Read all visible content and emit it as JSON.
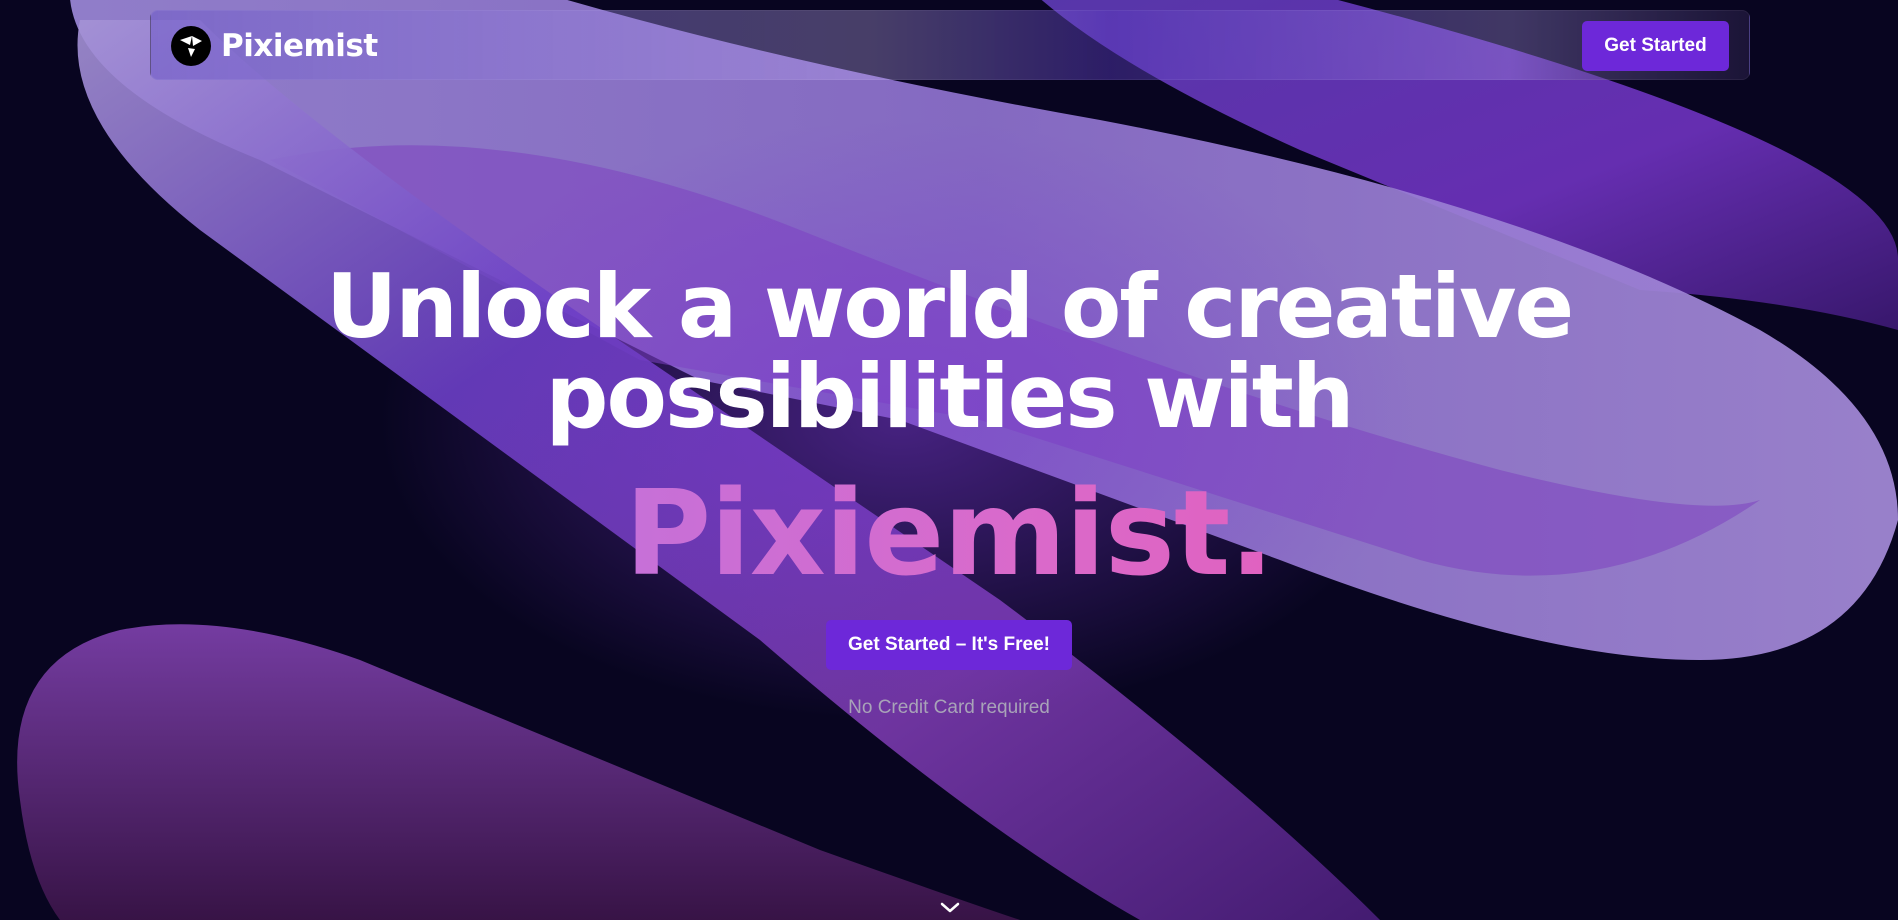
{
  "navbar": {
    "brand_name": "Pixiemist",
    "cta_label": "Get Started"
  },
  "hero": {
    "headline_line1": "Unlock a world of creative",
    "headline_line2": "possibilities with",
    "brand_highlight": "Pixiemist.",
    "cta_label": "Get Started – It's Free!",
    "note": "No Credit Card required"
  },
  "icons": {
    "logo": "pixiemist-logo-icon",
    "scroll": "chevron-down-icon"
  },
  "colors": {
    "background": "#080520",
    "accent": "#6d28d9",
    "highlight_start": "#c670d8",
    "highlight_end": "#e062c0",
    "note_text": "#a8a3b8"
  }
}
